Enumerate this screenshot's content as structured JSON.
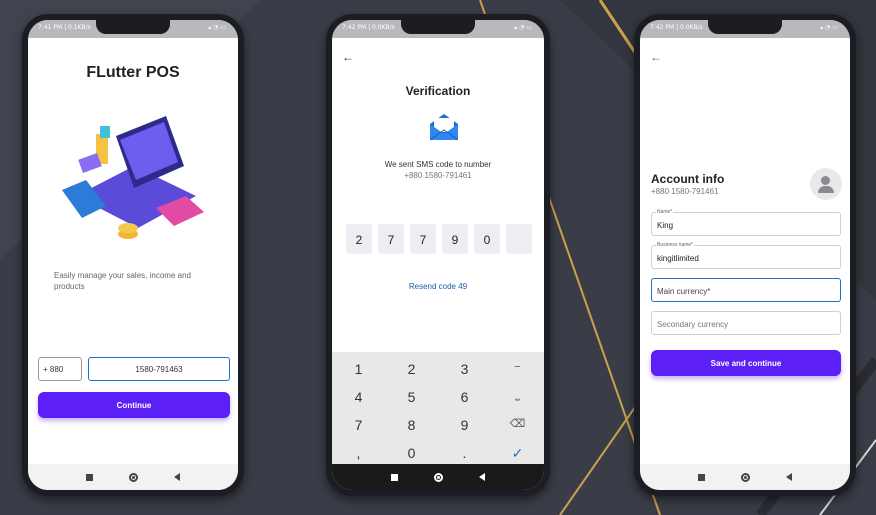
{
  "screen1": {
    "status": "7:41 PM | 0.1KB/s",
    "title": "FLutter POS",
    "description": "Easily manage your sales, income and products",
    "country_code": "+  880",
    "phone": "1580-791463",
    "continue_label": "Continue"
  },
  "screen2": {
    "status": "7:42 PM | 0.0KB/s",
    "title": "Verification",
    "sent_text": "We sent SMS code to number",
    "number": "+880 1580-791461",
    "otp_digits": [
      "2",
      "7",
      "7",
      "9",
      "0",
      ""
    ],
    "resend": "Resend code 49",
    "keys": [
      "1",
      "2",
      "3",
      "−",
      "4",
      "5",
      "6",
      "⎵",
      "7",
      "8",
      "9",
      "⌫",
      ",",
      "0",
      ".",
      "✓"
    ]
  },
  "screen3": {
    "status": "7:42 PM | 0.0KB/s",
    "title": "Account info",
    "number": "+880 1580-791461",
    "name_label": "Name*",
    "name_value": "King",
    "business_label": "Business name*",
    "business_value": "kingitlimited",
    "main_currency_placeholder": "Main currency*",
    "secondary_currency_placeholder": "Secondary currency",
    "save_label": "Save and continue"
  },
  "colors": {
    "accent": "#5c1ff5",
    "link": "#1a73c8",
    "background": "#3a3d47"
  }
}
